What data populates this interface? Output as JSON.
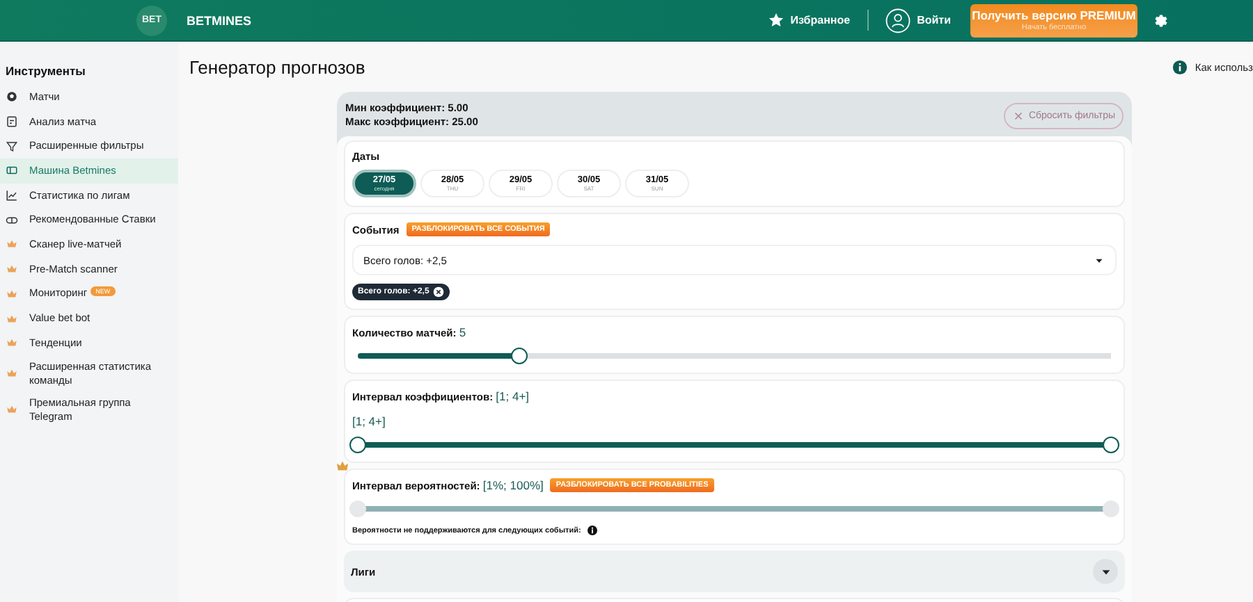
{
  "header": {
    "logo": "BET",
    "brand": "BETMINES",
    "favorites": "Избранное",
    "login": "Войти",
    "premium": {
      "title": "Получить версию PREMIUM",
      "subtitle": "Начать бесплатно"
    }
  },
  "sidebar": {
    "title": "Инструменты",
    "items": [
      {
        "label": "Матчи",
        "kind": "ball",
        "selected": false
      },
      {
        "label": "Анализ матча",
        "kind": "doc",
        "selected": false
      },
      {
        "label": "Расширенные фильтры",
        "kind": "filter",
        "selected": false
      },
      {
        "label": "Машина Betmines",
        "kind": "ticket",
        "selected": true
      },
      {
        "label": "Статистика по лигам",
        "kind": "chart",
        "selected": false
      },
      {
        "label": "Рекомендованные Ставки",
        "kind": "coupon",
        "selected": false
      },
      {
        "label": "Сканер live-матчей",
        "kind": "crown",
        "selected": false
      },
      {
        "label": "Pre-Match scanner",
        "kind": "crown",
        "selected": false
      },
      {
        "label": "Мониторинг",
        "kind": "crown",
        "selected": false,
        "badge": "NEW"
      },
      {
        "label": "Value bet bot",
        "kind": "crown",
        "selected": false
      },
      {
        "label": "Тенденции",
        "kind": "crown",
        "selected": false
      },
      {
        "label": "Расширенная статистика команды",
        "kind": "crown",
        "selected": false
      },
      {
        "label": "Премиальная группа Telegram",
        "kind": "crown",
        "selected": false
      }
    ]
  },
  "page": {
    "title": "Генератор прогнозов",
    "help": "Как использ"
  },
  "summary": {
    "min": "Мин коэффициент: 5.00",
    "max": "Макс коэффициент: 25.00",
    "reset": "Сбросить фильтры"
  },
  "dates": {
    "title": "Даты",
    "items": [
      {
        "date": "27/05",
        "day": "сегодня",
        "selected": true
      },
      {
        "date": "28/05",
        "day": "THU",
        "selected": false
      },
      {
        "date": "29/05",
        "day": "FRI",
        "selected": false
      },
      {
        "date": "30/05",
        "day": "SAT",
        "selected": false
      },
      {
        "date": "31/05",
        "day": "SUN",
        "selected": false
      }
    ]
  },
  "events": {
    "title": "События",
    "unlock": "РАЗБЛОКИРОВАТЬ ВСЕ СОБЫТИЯ",
    "select": "Всего голов: +2,5",
    "chips": [
      "Всего голов: +2,5"
    ]
  },
  "match_count": {
    "label": "Количество матчей:",
    "value": "5",
    "level": 0.215
  },
  "odds_interval": {
    "label": "Интервал коэффициентов:",
    "value": "[1; 4+]",
    "reading": "[1; 4+]",
    "thumbs": [
      {
        "level": 0
      },
      {
        "level": 1
      }
    ]
  },
  "probability": {
    "label": "Интервал вероятностей:",
    "value": "[1%; 100%]",
    "unlock": "РАЗБЛОКИРОВАТЬ ВСЕ PROBABILITIES",
    "disabled": true,
    "thumbs": [
      {
        "level": 0
      },
      {
        "level": 1
      }
    ],
    "note": "Вероятности не поддерживаются для следующих событий:"
  },
  "leagues": {
    "title": "Лиги",
    "expanded": false
  }
}
